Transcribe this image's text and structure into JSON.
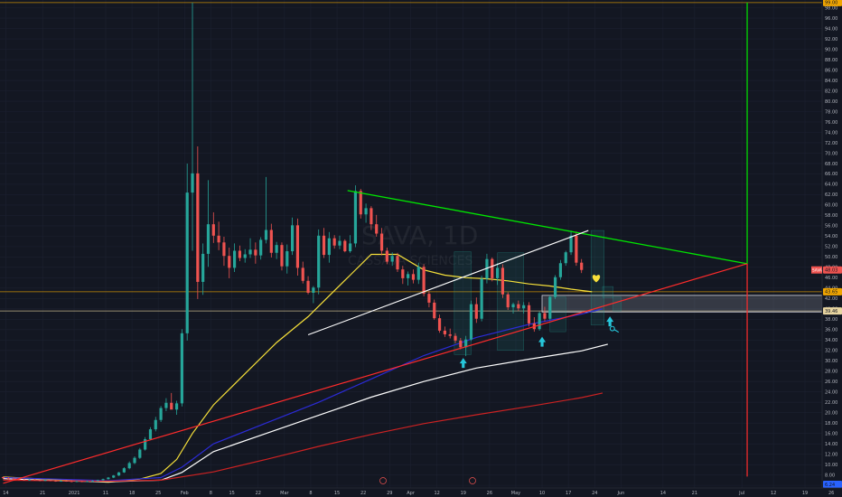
{
  "chart_data": {
    "type": "candlestick",
    "watermark": {
      "symbol": "SAVA, 1D",
      "name": "CASSAVA SCIENCES"
    },
    "price_axis": {
      "ylim": [
        5.5,
        99.5
      ],
      "ticks": [
        "98.00",
        "96.00",
        "94.00",
        "92.00",
        "90.00",
        "88.00",
        "86.00",
        "84.00",
        "82.00",
        "80.00",
        "78.00",
        "76.00",
        "74.00",
        "72.00",
        "70.00",
        "68.00",
        "66.00",
        "64.00",
        "62.00",
        "60.00",
        "58.00",
        "56.00",
        "54.00",
        "52.00",
        "50.00",
        "48.00",
        "46.00",
        "44.00",
        "42.00",
        "40.00",
        "38.00",
        "36.00",
        "34.00",
        "32.00",
        "30.00",
        "28.00",
        "26.00",
        "24.00",
        "22.00",
        "20.00",
        "18.00",
        "16.00",
        "14.00",
        "12.00",
        "10.00",
        "8.00",
        "6.00"
      ],
      "tags": [
        {
          "label": "SAVA",
          "value": "48.03",
          "price": 47.5,
          "color": "#ef5350"
        },
        {
          "label": "",
          "value": "43.65",
          "price": 43.3,
          "color": "#f0a500"
        },
        {
          "label": "",
          "value": "39.46",
          "price": 39.6,
          "color": "#e8d5a0"
        },
        {
          "label": "",
          "value": "99.00",
          "price": 99.0,
          "color": "#f0a500"
        },
        {
          "label": "",
          "value": "6.24",
          "price": 6.2,
          "color": "#2962ff"
        }
      ]
    },
    "time_axis": {
      "ticks": [
        {
          "label": "14",
          "x": 0.5
        },
        {
          "label": "21",
          "x": 7.5
        },
        {
          "label": "2021",
          "x": 13.5
        },
        {
          "label": "11",
          "x": 19.5
        },
        {
          "label": "18",
          "x": 24.5
        },
        {
          "label": "25",
          "x": 29.5
        },
        {
          "label": "Feb",
          "x": 34.5
        },
        {
          "label": "8",
          "x": 39.5
        },
        {
          "label": "15",
          "x": 43.5
        },
        {
          "label": "22",
          "x": 48.5
        },
        {
          "label": "Mar",
          "x": 53.5
        },
        {
          "label": "8",
          "x": 58.5
        },
        {
          "label": "15",
          "x": 63.5
        },
        {
          "label": "22",
          "x": 68.5
        },
        {
          "label": "29",
          "x": 73.5
        },
        {
          "label": "Apr",
          "x": 77.5
        },
        {
          "label": "12",
          "x": 82.5
        },
        {
          "label": "19",
          "x": 87.5
        },
        {
          "label": "26",
          "x": 92.5
        },
        {
          "label": "May",
          "x": 97.5
        },
        {
          "label": "10",
          "x": 102.5
        },
        {
          "label": "17",
          "x": 107.5
        },
        {
          "label": "24",
          "x": 112.5
        },
        {
          "label": "Jun",
          "x": 117.5
        },
        {
          "label": "14",
          "x": 125.5
        },
        {
          "label": "21",
          "x": 131.5
        },
        {
          "label": "Jul",
          "x": 140.5
        },
        {
          "label": "12",
          "x": 146.5
        },
        {
          "label": "19",
          "x": 152.5
        },
        {
          "label": "26",
          "x": 157.5
        }
      ]
    },
    "candles": [
      [
        7.6,
        7.7,
        7.2,
        7.4
      ],
      [
        7.4,
        7.6,
        7.1,
        7.3
      ],
      [
        7.3,
        7.5,
        7.0,
        7.2
      ],
      [
        7.2,
        7.4,
        7.0,
        7.1
      ],
      [
        7.1,
        7.3,
        6.9,
        7.0
      ],
      [
        7.0,
        7.2,
        6.9,
        7.1
      ],
      [
        7.1,
        7.2,
        6.9,
        7.0
      ],
      [
        7.0,
        7.1,
        6.8,
        6.9
      ],
      [
        6.9,
        7.1,
        6.8,
        7.0
      ],
      [
        7.0,
        7.1,
        6.8,
        6.9
      ],
      [
        6.9,
        7.0,
        6.7,
        6.8
      ],
      [
        6.8,
        7.0,
        6.7,
        6.9
      ],
      [
        6.9,
        7.0,
        6.7,
        6.8
      ],
      [
        6.8,
        7.0,
        6.6,
        6.7
      ],
      [
        6.7,
        6.9,
        6.6,
        6.8
      ],
      [
        6.8,
        6.9,
        6.6,
        6.7
      ],
      [
        6.7,
        6.9,
        6.6,
        6.8
      ],
      [
        6.8,
        7.0,
        6.7,
        6.9
      ],
      [
        6.9,
        7.1,
        6.8,
        7.0
      ],
      [
        7.0,
        7.3,
        6.9,
        7.2
      ],
      [
        7.2,
        7.6,
        7.1,
        7.5
      ],
      [
        7.5,
        8.0,
        7.4,
        7.9
      ],
      [
        7.9,
        8.6,
        7.8,
        8.5
      ],
      [
        8.5,
        9.5,
        8.4,
        9.3
      ],
      [
        9.3,
        10.6,
        9.1,
        10.3
      ],
      [
        10.3,
        11.6,
        10.1,
        11.3
      ],
      [
        11.3,
        13.2,
        11.1,
        12.9
      ],
      [
        12.9,
        15.3,
        12.7,
        14.9
      ],
      [
        14.9,
        17.2,
        14.7,
        16.8
      ],
      [
        16.8,
        19.2,
        16.4,
        18.6
      ],
      [
        18.6,
        21.3,
        18.2,
        20.9
      ],
      [
        20.9,
        22.8,
        20.3,
        21.9
      ],
      [
        21.9,
        23.8,
        21.1,
        20.6
      ],
      [
        20.6,
        22.3,
        19.6,
        21.8
      ],
      [
        21.8,
        36.1,
        21.2,
        35.3
      ],
      [
        35.3,
        68.0,
        33.9,
        62.4
      ],
      [
        62.4,
        99.0,
        51.2,
        66.1
      ],
      [
        66.1,
        71.3,
        41.9,
        45.2
      ],
      [
        45.2,
        52.6,
        42.7,
        50.6
      ],
      [
        50.6,
        64.8,
        48.1,
        56.3
      ],
      [
        56.3,
        58.6,
        52.7,
        54.1
      ],
      [
        54.1,
        56.8,
        51.3,
        52.8
      ],
      [
        52.8,
        53.9,
        48.3,
        50.2
      ],
      [
        50.2,
        51.8,
        45.9,
        47.9
      ],
      [
        47.9,
        52.6,
        47.1,
        51.2
      ],
      [
        51.2,
        52.2,
        49.2,
        49.8
      ],
      [
        49.8,
        51.5,
        48.9,
        50.5
      ],
      [
        50.5,
        53.6,
        49.8,
        51.4
      ],
      [
        51.4,
        52.8,
        48.7,
        50.3
      ],
      [
        50.3,
        53.8,
        49.5,
        53.3
      ],
      [
        53.3,
        65.4,
        52.6,
        55.2
      ],
      [
        55.2,
        56.4,
        49.9,
        50.8
      ],
      [
        50.8,
        52.9,
        49.6,
        52.3
      ],
      [
        52.3,
        52.8,
        47.4,
        48.2
      ],
      [
        48.2,
        52.4,
        46.8,
        51.1
      ],
      [
        51.1,
        57.6,
        50.4,
        56.1
      ],
      [
        56.1,
        57.4,
        46.4,
        47.9
      ],
      [
        47.9,
        49.1,
        44.9,
        45.4
      ],
      [
        45.4,
        46.3,
        42.8,
        43.1
      ],
      [
        43.1,
        44.4,
        41.1,
        44.1
      ],
      [
        44.1,
        55.3,
        42.8,
        54.1
      ],
      [
        54.1,
        55.6,
        49.8,
        50.4
      ],
      [
        50.4,
        54.8,
        48.9,
        53.6
      ],
      [
        53.6,
        54.2,
        51.6,
        52.2
      ],
      [
        52.2,
        54.1,
        51.5,
        53.1
      ],
      [
        53.1,
        53.4,
        50.9,
        51.1
      ],
      [
        51.1,
        54.2,
        50.8,
        52.6
      ],
      [
        52.6,
        63.8,
        51.9,
        62.7
      ],
      [
        62.7,
        63.1,
        57.4,
        58.2
      ],
      [
        58.2,
        60.3,
        56.6,
        59.4
      ],
      [
        59.4,
        59.8,
        55.2,
        56.3
      ],
      [
        56.3,
        58.1,
        53.9,
        54.5
      ],
      [
        54.5,
        55.6,
        50.3,
        51.2
      ],
      [
        51.2,
        51.8,
        48.6,
        49.1
      ],
      [
        49.1,
        50.9,
        48.3,
        50.2
      ],
      [
        50.2,
        50.8,
        47.1,
        47.6
      ],
      [
        47.6,
        48.3,
        44.8,
        45.9
      ],
      [
        45.9,
        47.2,
        44.5,
        46.7
      ],
      [
        46.7,
        47.6,
        44.9,
        45.6
      ],
      [
        45.6,
        48.9,
        44.8,
        48.1
      ],
      [
        48.1,
        48.6,
        42.4,
        42.9
      ],
      [
        42.9,
        43.4,
        40.3,
        41.2
      ],
      [
        41.2,
        41.8,
        37.9,
        38.2
      ],
      [
        38.2,
        38.9,
        35.4,
        35.8
      ],
      [
        35.8,
        36.6,
        34.6,
        35.1
      ],
      [
        35.1,
        36.2,
        34.3,
        34.8
      ],
      [
        34.8,
        35.3,
        33.4,
        33.9
      ],
      [
        33.9,
        34.4,
        32.2,
        32.6
      ],
      [
        32.6,
        34.8,
        30.9,
        34.1
      ],
      [
        34.1,
        41.6,
        33.8,
        40.9
      ],
      [
        40.9,
        42.2,
        37.3,
        38.1
      ],
      [
        38.1,
        46.4,
        37.6,
        45.8
      ],
      [
        45.8,
        50.6,
        44.9,
        49.6
      ],
      [
        49.6,
        49.9,
        45.3,
        45.9
      ],
      [
        45.9,
        48.8,
        44.6,
        47.9
      ],
      [
        47.9,
        48.6,
        42.1,
        42.8
      ],
      [
        42.8,
        43.2,
        39.8,
        40.3
      ],
      [
        40.3,
        41.2,
        39.1,
        40.9
      ],
      [
        40.9,
        41.6,
        39.6,
        40.1
      ],
      [
        40.1,
        41.3,
        39.1,
        40.7
      ],
      [
        40.7,
        41.3,
        36.6,
        37.2
      ],
      [
        37.2,
        38.4,
        35.6,
        36.1
      ],
      [
        36.1,
        39.5,
        35.8,
        39.2
      ],
      [
        39.2,
        40.4,
        37.6,
        38.1
      ],
      [
        38.1,
        42.6,
        37.8,
        42.3
      ],
      [
        42.3,
        46.5,
        41.9,
        46.1
      ],
      [
        46.1,
        49.4,
        45.6,
        48.8
      ],
      [
        48.8,
        51.2,
        48.3,
        50.9
      ],
      [
        50.9,
        55.1,
        50.4,
        54.1
      ],
      [
        54.1,
        54.9,
        48.3,
        48.9
      ],
      [
        48.9,
        49.6,
        46.9,
        47.5
      ]
    ],
    "series": [
      {
        "type": "line",
        "color": "#f6e03a",
        "x": [
          0,
          10,
          20,
          26,
          30,
          33,
          36,
          40,
          46,
          52,
          58,
          62,
          66,
          70,
          75,
          80,
          84,
          88,
          92,
          96,
          100,
          104,
          108,
          112
        ],
        "y": [
          7.6,
          7.1,
          6.6,
          7.2,
          8.3,
          11.0,
          16.0,
          21.5,
          27.5,
          33.5,
          38.5,
          42.5,
          46.5,
          50.5,
          50.5,
          47.5,
          46.5,
          46.0,
          45.8,
          45.4,
          44.8,
          44.4,
          43.8,
          43.3
        ]
      },
      {
        "type": "line",
        "color": "#2b2bd6",
        "x": [
          0,
          10,
          20,
          30,
          34,
          40,
          50,
          60,
          70,
          80,
          90,
          100,
          110,
          114
        ],
        "y": [
          7.5,
          7.2,
          6.9,
          7.5,
          9.5,
          14.0,
          18.0,
          22.0,
          26.5,
          31.0,
          34.5,
          37.0,
          39.0,
          40.0
        ]
      },
      {
        "type": "line",
        "color": "#ffffff",
        "x": [
          0,
          10,
          20,
          30,
          34,
          40,
          50,
          60,
          70,
          80,
          90,
          100,
          110,
          115
        ],
        "y": [
          7.3,
          6.9,
          6.7,
          7.0,
          8.5,
          12.5,
          16.0,
          19.5,
          23.0,
          26.0,
          28.6,
          30.3,
          31.9,
          33.2
        ]
      },
      {
        "type": "line",
        "color": "#cc2222",
        "x": [
          0,
          10,
          20,
          30,
          40,
          50,
          60,
          70,
          80,
          90,
          100,
          110,
          114
        ],
        "y": [
          7.0,
          6.9,
          6.8,
          7.0,
          8.6,
          11.0,
          13.5,
          15.8,
          17.9,
          19.6,
          21.2,
          22.9,
          23.8
        ]
      }
    ]
  }
}
